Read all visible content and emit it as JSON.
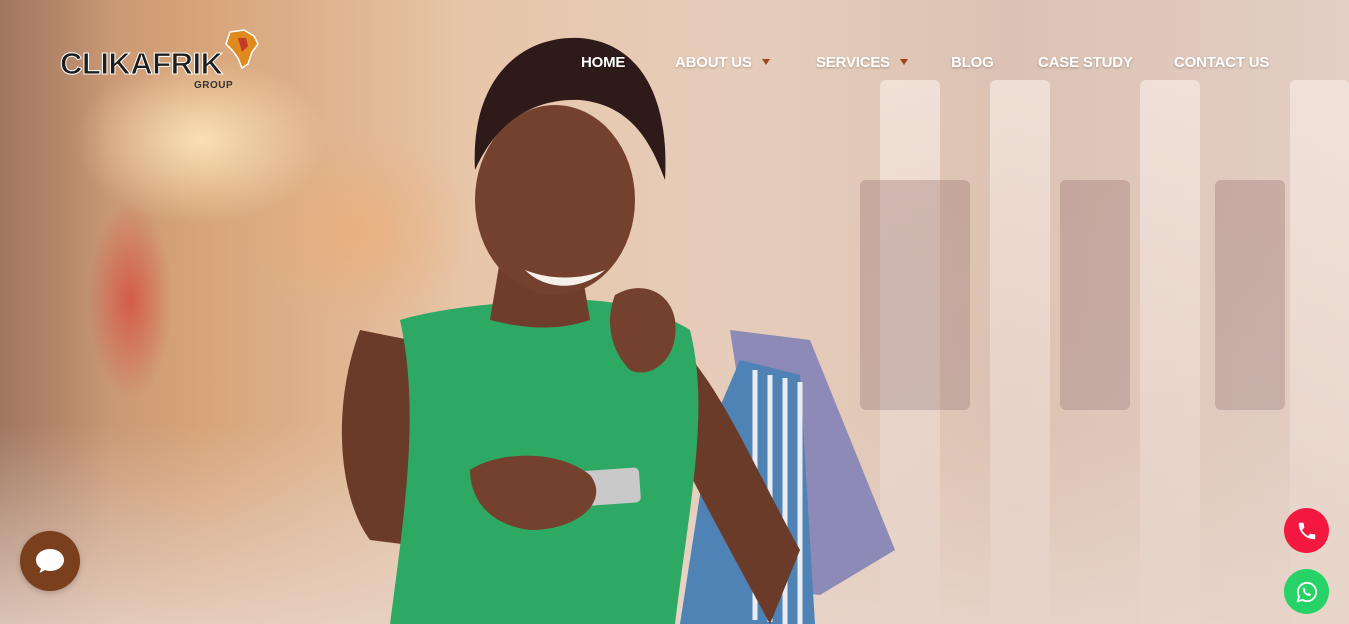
{
  "brand": {
    "name": "CLIKAFRIK",
    "subtitle": "GROUP",
    "colors": {
      "accent": "#a0461a",
      "chat": "#7a3f1d",
      "phone": "#f2183f",
      "whatsapp": "#27d366"
    }
  },
  "nav": {
    "items": [
      {
        "label": "HOME",
        "has_dropdown": false
      },
      {
        "label": "ABOUT US",
        "has_dropdown": true
      },
      {
        "label": "SERVICES",
        "has_dropdown": true
      },
      {
        "label": "BLOG",
        "has_dropdown": false
      },
      {
        "label": "CASE STUDY",
        "has_dropdown": false
      },
      {
        "label": "CONTACT US",
        "has_dropdown": false
      }
    ]
  },
  "hero": {
    "image": "woman-green-dress-shopping-bags-phone"
  },
  "floating": {
    "chat_icon": "chat-bubble-icon",
    "phone_icon": "phone-icon",
    "whatsapp_icon": "whatsapp-icon"
  }
}
